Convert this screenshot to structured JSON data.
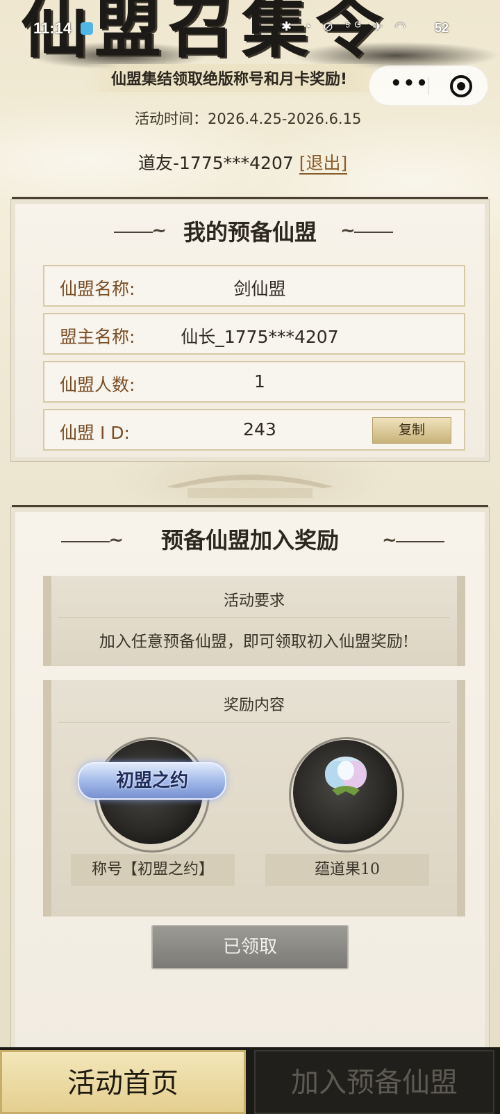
{
  "status_bar": {
    "time": "11:14",
    "icons": "✱ ◔ ⊘ ⁵ᴳ ✈ ◠",
    "battery": "52"
  },
  "header": {
    "banner_title": "仙盟召集令",
    "subtitle": "仙盟集结领取绝版称号和月卡奖励!",
    "activity_time": "活动时间：2026.4.25-2026.6.15",
    "user_name": "道友-1775***4207",
    "logout_label": "[退出]",
    "more_label": "•••"
  },
  "my_alliance": {
    "title": "我的预备仙盟",
    "rows": [
      {
        "label": "仙盟名称:",
        "value": "剑仙盟"
      },
      {
        "label": "盟主名称:",
        "value": "仙长_1775***4207"
      },
      {
        "label": "仙盟人数:",
        "value": "1"
      },
      {
        "label": "仙盟 I D:",
        "value": "243"
      }
    ],
    "copy_label": "复制"
  },
  "join_reward": {
    "title": "预备仙盟加入奖励",
    "requirement_heading": "活动要求",
    "requirement_text": "加入任意预备仙盟，即可领取初入仙盟奖励!",
    "reward_heading": "奖励内容",
    "rewards": [
      {
        "badge_text": "初盟之约",
        "label": "称号【初盟之约】"
      },
      {
        "icon": "spirit-fruit-icon",
        "label": "蕴道果10"
      }
    ],
    "claim_button": "已领取"
  },
  "bottom_nav": {
    "home": "活动首页",
    "join": "加入预备仙盟"
  }
}
